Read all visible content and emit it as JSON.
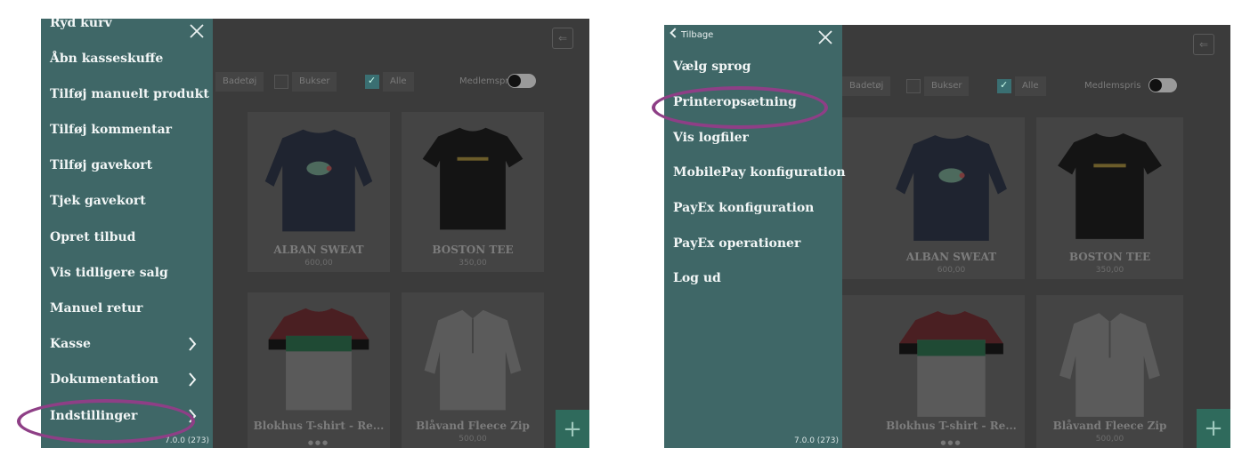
{
  "colors": {
    "menu_bg": "#3f6767",
    "overlay_bg": "#3b3b3b",
    "highlight_ring": "#8e3f86",
    "fab": "#2f6a5c"
  },
  "left": {
    "menu": {
      "items": [
        {
          "label": "Ryd kurv"
        },
        {
          "label": "Åbn kasseskuffe"
        },
        {
          "label": "Tilføj manuelt produkt"
        },
        {
          "label": "Tilføj kommentar"
        },
        {
          "label": "Tilføj gavekort"
        },
        {
          "label": "Tjek gavekort"
        },
        {
          "label": "Opret tilbud"
        },
        {
          "label": "Vis tidligere salg"
        },
        {
          "label": "Manuel retur"
        },
        {
          "label": "Kasse",
          "has_submenu": true
        },
        {
          "label": "Dokumentation",
          "has_submenu": true
        },
        {
          "label": "Indstillinger",
          "has_submenu": true,
          "highlighted": true
        }
      ],
      "version": "7.0.0 (273)",
      "close_icon": "close-icon"
    },
    "filters": {
      "items": [
        "Badetøj",
        "Bukser",
        "Alle"
      ],
      "selected": "Alle",
      "member_price_label": "Medlemspris"
    },
    "products": [
      {
        "name": "ALBAN SWEAT",
        "price": "600,00"
      },
      {
        "name": "BOSTON TEE",
        "price": "350,00"
      },
      {
        "name": "Blokhus T-shirt - Re...",
        "price": ""
      },
      {
        "name": "Blåvand Fleece Zip",
        "price": "500,00"
      }
    ]
  },
  "right": {
    "menu": {
      "back_label": "Tilbage",
      "items": [
        {
          "label": "Vælg sprog"
        },
        {
          "label": "Printeropsætning",
          "highlighted": true
        },
        {
          "label": "Vis logfiler"
        },
        {
          "label": "MobilePay konfiguration"
        },
        {
          "label": "PayEx konfiguration"
        },
        {
          "label": "PayEx operationer"
        },
        {
          "label": "Log ud"
        }
      ],
      "version": "7.0.0 (273)",
      "close_icon": "close-icon"
    },
    "filters": {
      "items": [
        "Badetøj",
        "Bukser",
        "Alle"
      ],
      "selected": "Alle",
      "member_price_label": "Medlemspris"
    },
    "products": [
      {
        "name": "ALBAN SWEAT",
        "price": "600,00"
      },
      {
        "name": "BOSTON TEE",
        "price": "350,00"
      },
      {
        "name": "Blokhus T-shirt - Re...",
        "price": ""
      },
      {
        "name": "Blåvand Fleece Zip",
        "price": "500,00"
      }
    ]
  }
}
